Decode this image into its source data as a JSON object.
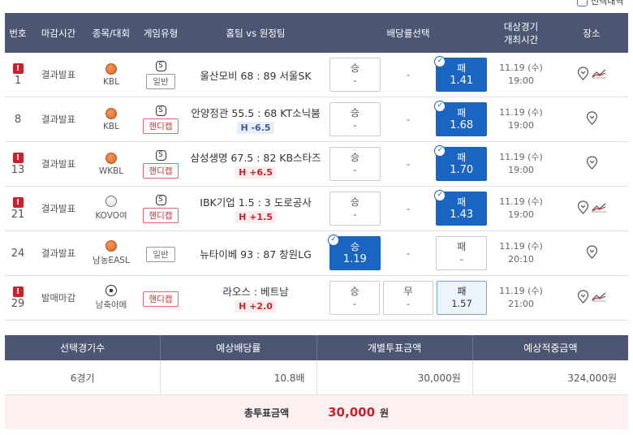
{
  "top": {
    "checkbox_label": "선택내역"
  },
  "headers": {
    "num": "번호",
    "state": "마감시간",
    "league": "종목/대회",
    "type": "게임유형",
    "match": "홈팀 vs 원정팀",
    "odds": "배당률선택",
    "time_line1": "대상경기",
    "time_line2": "개최시간",
    "venue": "장소"
  },
  "rows": [
    {
      "alert": true,
      "num": "1",
      "state": "결과발표",
      "sport": "basketball",
      "league": "KBL",
      "s_badge": "S",
      "type": "일반",
      "type_style": "normal",
      "match": "울산모비 68 : 89 서울SK",
      "handicap": "",
      "handicap_style": "",
      "odds": [
        {
          "label": "승",
          "value": "-",
          "style": "normal"
        },
        {
          "label": "",
          "value": "-",
          "style": "dash"
        },
        {
          "label": "패",
          "value": "1.41",
          "style": "sel"
        }
      ],
      "date": "11.19 (수)",
      "clock": "19:00",
      "trend": true
    },
    {
      "alert": false,
      "num": "8",
      "state": "결과발표",
      "sport": "basketball",
      "league": "KBL",
      "s_badge": "S",
      "type": "핸디캡",
      "type_style": "hc",
      "match": "안양정관 55.5 : 68 KT소닉붐",
      "handicap": "H -6.5",
      "handicap_style": "neg",
      "odds": [
        {
          "label": "승",
          "value": "-",
          "style": "normal"
        },
        {
          "label": "",
          "value": "-",
          "style": "dash"
        },
        {
          "label": "패",
          "value": "1.68",
          "style": "sel"
        }
      ],
      "date": "11.19 (수)",
      "clock": "19:00",
      "trend": false
    },
    {
      "alert": true,
      "num": "13",
      "state": "결과발표",
      "sport": "basketball",
      "league": "WKBL",
      "s_badge": "S",
      "type": "핸디캡",
      "type_style": "hc",
      "match": "삼성생명 67.5 : 82 KB스타즈",
      "handicap": "H +6.5",
      "handicap_style": "pos",
      "odds": [
        {
          "label": "승",
          "value": "-",
          "style": "normal"
        },
        {
          "label": "",
          "value": "-",
          "style": "dash"
        },
        {
          "label": "패",
          "value": "1.70",
          "style": "sel"
        }
      ],
      "date": "11.19 (수)",
      "clock": "19:00",
      "trend": false
    },
    {
      "alert": true,
      "num": "21",
      "state": "결과발표",
      "sport": "volleyball",
      "league": "KOVO여",
      "s_badge": "S",
      "type": "핸디캡",
      "type_style": "hc",
      "match": "IBK기업 1.5 : 3 도로공사",
      "handicap": "H +1.5",
      "handicap_style": "pos",
      "odds": [
        {
          "label": "승",
          "value": "-",
          "style": "normal"
        },
        {
          "label": "",
          "value": "-",
          "style": "dash"
        },
        {
          "label": "패",
          "value": "1.43",
          "style": "sel"
        }
      ],
      "date": "11.19 (수)",
      "clock": "19:00",
      "trend": true
    },
    {
      "alert": false,
      "num": "24",
      "state": "결과발표",
      "sport": "basketball",
      "league": "남농EASL",
      "s_badge": "",
      "type": "일반",
      "type_style": "normal",
      "match": "뉴타이베 93 : 87 창원LG",
      "handicap": "",
      "handicap_style": "",
      "odds": [
        {
          "label": "승",
          "value": "1.19",
          "style": "sel"
        },
        {
          "label": "",
          "value": "-",
          "style": "dash"
        },
        {
          "label": "패",
          "value": "-",
          "style": "normal"
        }
      ],
      "date": "11.19 (수)",
      "clock": "20:10",
      "trend": false
    },
    {
      "alert": true,
      "num": "29",
      "state": "발매마감",
      "sport": "soccer",
      "league": "남축아메",
      "s_badge": "",
      "type": "핸디캡",
      "type_style": "hc",
      "match": "라오스 : 베트남",
      "handicap": "H +2.0",
      "handicap_style": "pos",
      "odds": [
        {
          "label": "승",
          "value": "-",
          "style": "normal"
        },
        {
          "label": "무",
          "value": "-",
          "style": "normal"
        },
        {
          "label": "패",
          "value": "1.57",
          "style": "lite"
        }
      ],
      "date": "11.19 (수)",
      "clock": "21:00",
      "trend": true
    }
  ],
  "summary": {
    "headers": [
      "선택경기수",
      "예상배당률",
      "개별투표금액",
      "예상적중금액"
    ],
    "values": [
      "6경기",
      "10.8배",
      "30,000원",
      "324,000원"
    ]
  },
  "total": {
    "label": "총투표금액",
    "value": "30,000",
    "unit": "원"
  },
  "colors": {
    "header_bg": "#4c5673",
    "selected": "#1a65c2",
    "alert": "#c8222e",
    "total_bg": "#fcf0f0"
  }
}
